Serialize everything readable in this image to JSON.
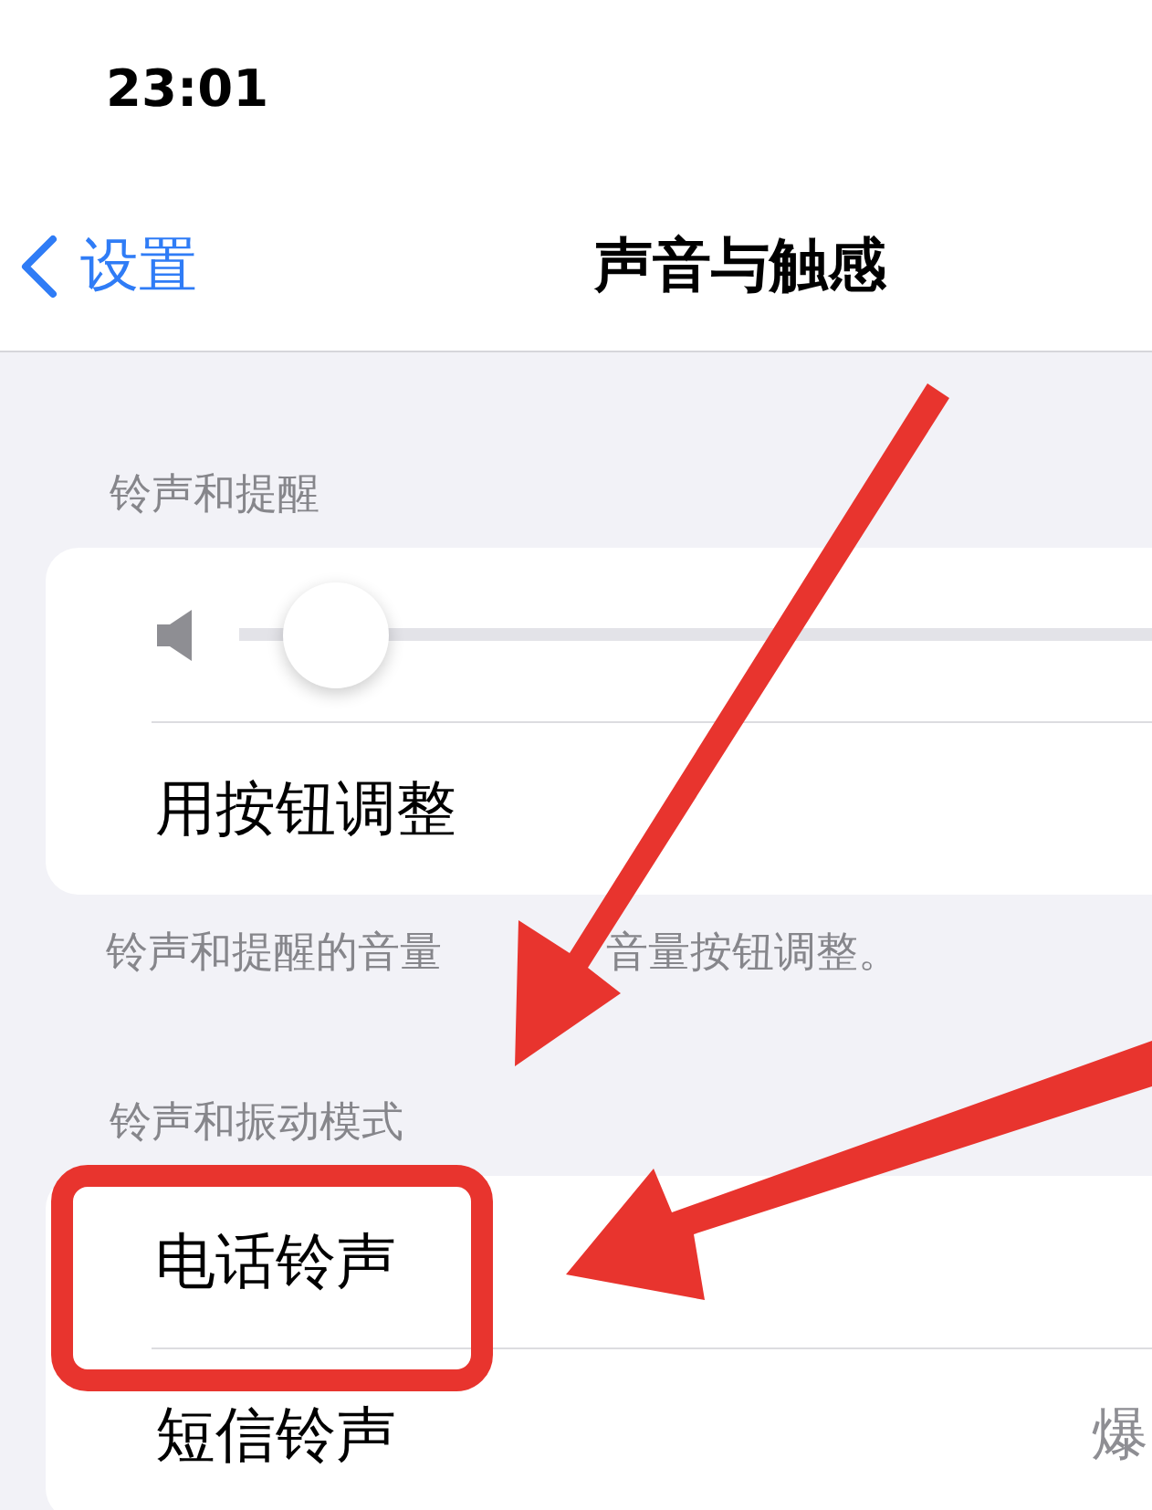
{
  "status_bar": {
    "time": "23:01"
  },
  "nav": {
    "back": "设置",
    "title": "声音与触感"
  },
  "sections": [
    {
      "header": "铃声和提醒",
      "rows": [
        {
          "kind": "slider",
          "level": 0.05
        },
        {
          "kind": "label",
          "label": "用按钮调整"
        }
      ],
      "footer": [
        "铃声和提醒的音量",
        "音量按钮调整。"
      ]
    },
    {
      "header": "铃声和振动模式",
      "rows": [
        {
          "kind": "label",
          "label": "电话铃声",
          "highlighted": true
        },
        {
          "kind": "label",
          "label": "短信铃声",
          "value": "爆"
        }
      ]
    }
  ],
  "annotations": [
    {
      "kind": "arrow"
    },
    {
      "kind": "arrow"
    }
  ]
}
